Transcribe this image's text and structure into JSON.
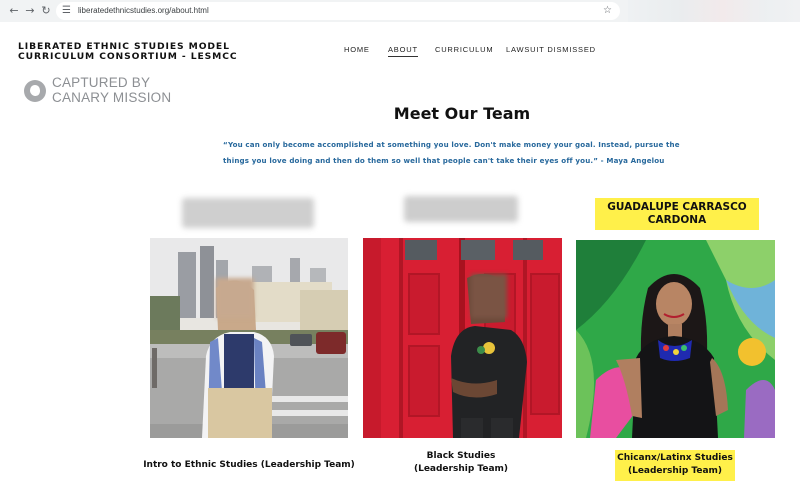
{
  "browser": {
    "url": "liberatedethnicstudies.org/about.html",
    "back_icon": "back-arrow-icon",
    "forward_icon": "forward-arrow-icon",
    "reload_icon": "reload-icon",
    "site_info_icon": "site-info-icon",
    "bookmark_icon": "star-icon"
  },
  "site": {
    "title_line1": "LIBERATED ETHNIC STUDIES MODEL",
    "title_line2": "CURRICULUM CONSORTIUM - LESMCC",
    "nav": [
      {
        "label": "HOME",
        "active": false
      },
      {
        "label": "ABOUT",
        "active": true
      },
      {
        "label": "CURRICULUM",
        "active": false
      },
      {
        "label": "LAWSUIT DISMISSED",
        "active": false
      }
    ]
  },
  "watermark": {
    "line1": "CAPTURED BY",
    "line2": "CANARY MISSION"
  },
  "main": {
    "title": "Meet Our Team",
    "quote_line1": "“You can only become accomplished at something you love. Don't make money your goal. Instead, pursue the",
    "quote_line2": "things you love doing and then do them so well that people can't take their eyes off you.” - Maya Angelou"
  },
  "team": [
    {
      "name": "",
      "caption_line1": "Intro to Ethnic Studies (Leadership Team)",
      "caption_line2": ""
    },
    {
      "name": "",
      "caption_line1": "Black Studies",
      "caption_line2": "(Leadership Team)"
    },
    {
      "name_line1": "GUADALUPE CARRASCO",
      "name_line2": "CARDONA",
      "caption_line1": "Chicanx/Latinx Studies",
      "caption_line2": "(Leadership Team)"
    }
  ],
  "colors": {
    "accent_yellow": "#fff04a",
    "quote_blue": "#27689c",
    "door_red": "#d81f33"
  }
}
